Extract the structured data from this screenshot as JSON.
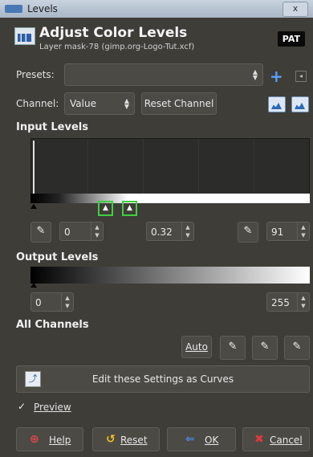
{
  "window": {
    "title": "Levels",
    "close_label": "x"
  },
  "header": {
    "title": "Adjust Color Levels",
    "subtitle": "Layer mask-78 (gimp.org-Logo-Tut.xcf)",
    "badge": "PAT"
  },
  "presets": {
    "label": "Presets:",
    "value": "",
    "add_icon": "+",
    "menu_icon": "◂"
  },
  "channel": {
    "label": "Channel:",
    "value": "Value",
    "reset_label": "Reset Channel"
  },
  "input_levels": {
    "heading": "Input Levels",
    "low_value": "0",
    "gamma_value": "0.32",
    "high_value": "91"
  },
  "output_levels": {
    "heading": "Output Levels",
    "low_value": "0",
    "high_value": "255"
  },
  "all_channels": {
    "heading": "All Channels",
    "auto_label": "Auto"
  },
  "curves_button": {
    "label": "Edit these Settings as Curves"
  },
  "preview": {
    "label": "Preview",
    "checked": true,
    "check_glyph": "✓"
  },
  "actions": {
    "help": "Help",
    "reset": "Reset",
    "ok": "OK",
    "cancel": "Cancel"
  },
  "colors": {
    "background": "#3e3d38",
    "accent_blue": "#5aa0ff",
    "handle_highlight": "#3fcf3f"
  }
}
